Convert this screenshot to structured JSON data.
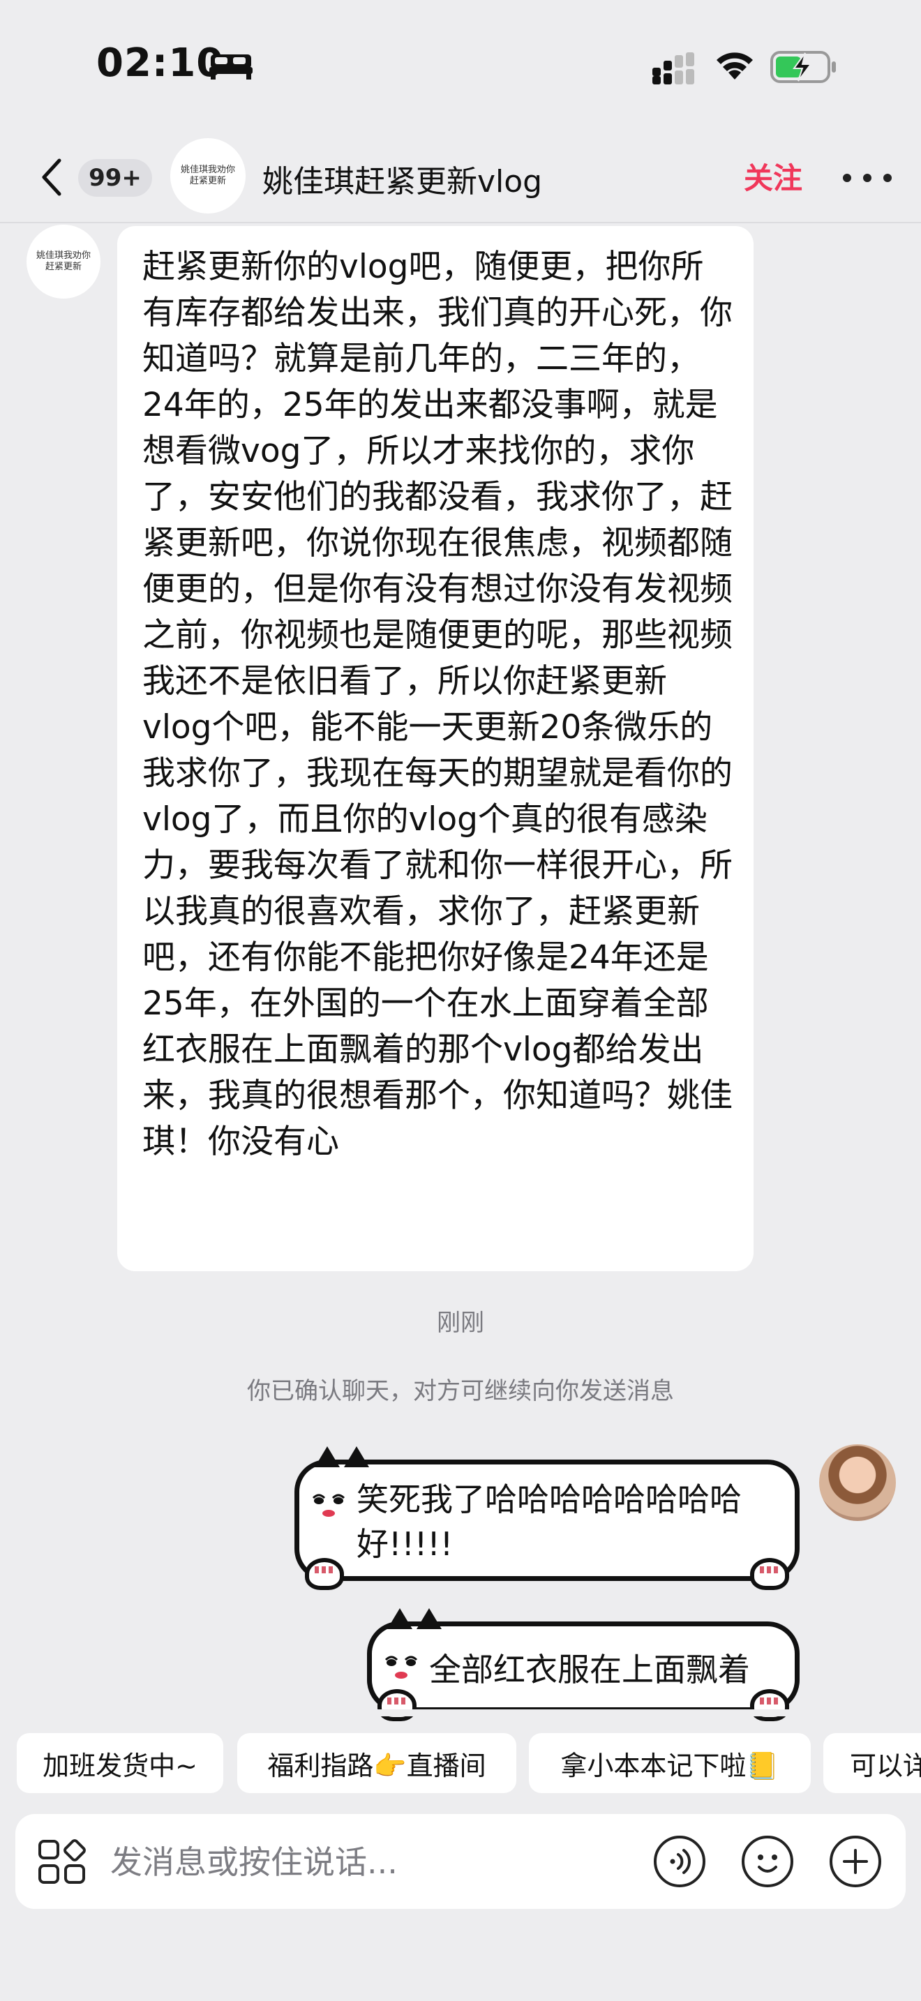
{
  "status_bar": {
    "time": "02:10"
  },
  "header": {
    "unread_count": "99+",
    "avatar_text_line1": "姚佳琪我劝你",
    "avatar_text_line2": "赶紧更新",
    "title": "姚佳琪赶紧更新vlog",
    "follow_label": "关注"
  },
  "incoming_message": {
    "sender_avatar_line1": "姚佳琪我劝你",
    "sender_avatar_line2": "赶紧更新",
    "text": "赶紧更新你的vlog吧，随便更，把你所有库存都给发出来，我们真的开心死，你知道吗？就算是前几年的，二三年的，24年的，25年的发出来都没事啊，就是想看微vog了，所以才来找你的，求你了，安安他们的我都没看，我求你了，赶紧更新吧，你说你现在很焦虑，视频都随便更的，但是你有没有想过你没有发视频之前，你视频也是随便更的呢，那些视频我还不是依旧看了，所以你赶紧更新vlog个吧，能不能一天更新20条微乐的我求你了，我现在每天的期望就是看你的vlog了，而且你的vlog个真的很有感染力，要我每次看了就和你一样很开心，所以我真的很喜欢看，求你了，赶紧更新吧，还有你能不能把你好像是24年还是25年，在外国的一个在水上面穿着全部红衣服在上面飘着的那个vlog都给发出来，我真的很想看那个，你知道吗？姚佳琪！你没有心"
  },
  "timestamp": "刚刚",
  "system_notice": "你已确认聊天，对方可继续向你发送消息",
  "outgoing_messages": [
    {
      "text": "笑死我了哈哈哈哈哈哈哈哈好!!!!!"
    },
    {
      "text": "全部红衣服在上面飘着"
    }
  ],
  "quick_replies": [
    "加班发货中~",
    "福利指路👉直播间",
    "拿小本本记下啦📒",
    "可以详"
  ],
  "input": {
    "placeholder": "发消息或按住说话..."
  },
  "colors": {
    "follow": "#f0375a",
    "background": "#ededef"
  },
  "icons": [
    "bed-icon",
    "signal-icon",
    "wifi-icon",
    "battery-charging-icon",
    "back-icon",
    "more-icon",
    "apps-icon",
    "voice-icon",
    "emoji-icon",
    "plus-icon"
  ]
}
